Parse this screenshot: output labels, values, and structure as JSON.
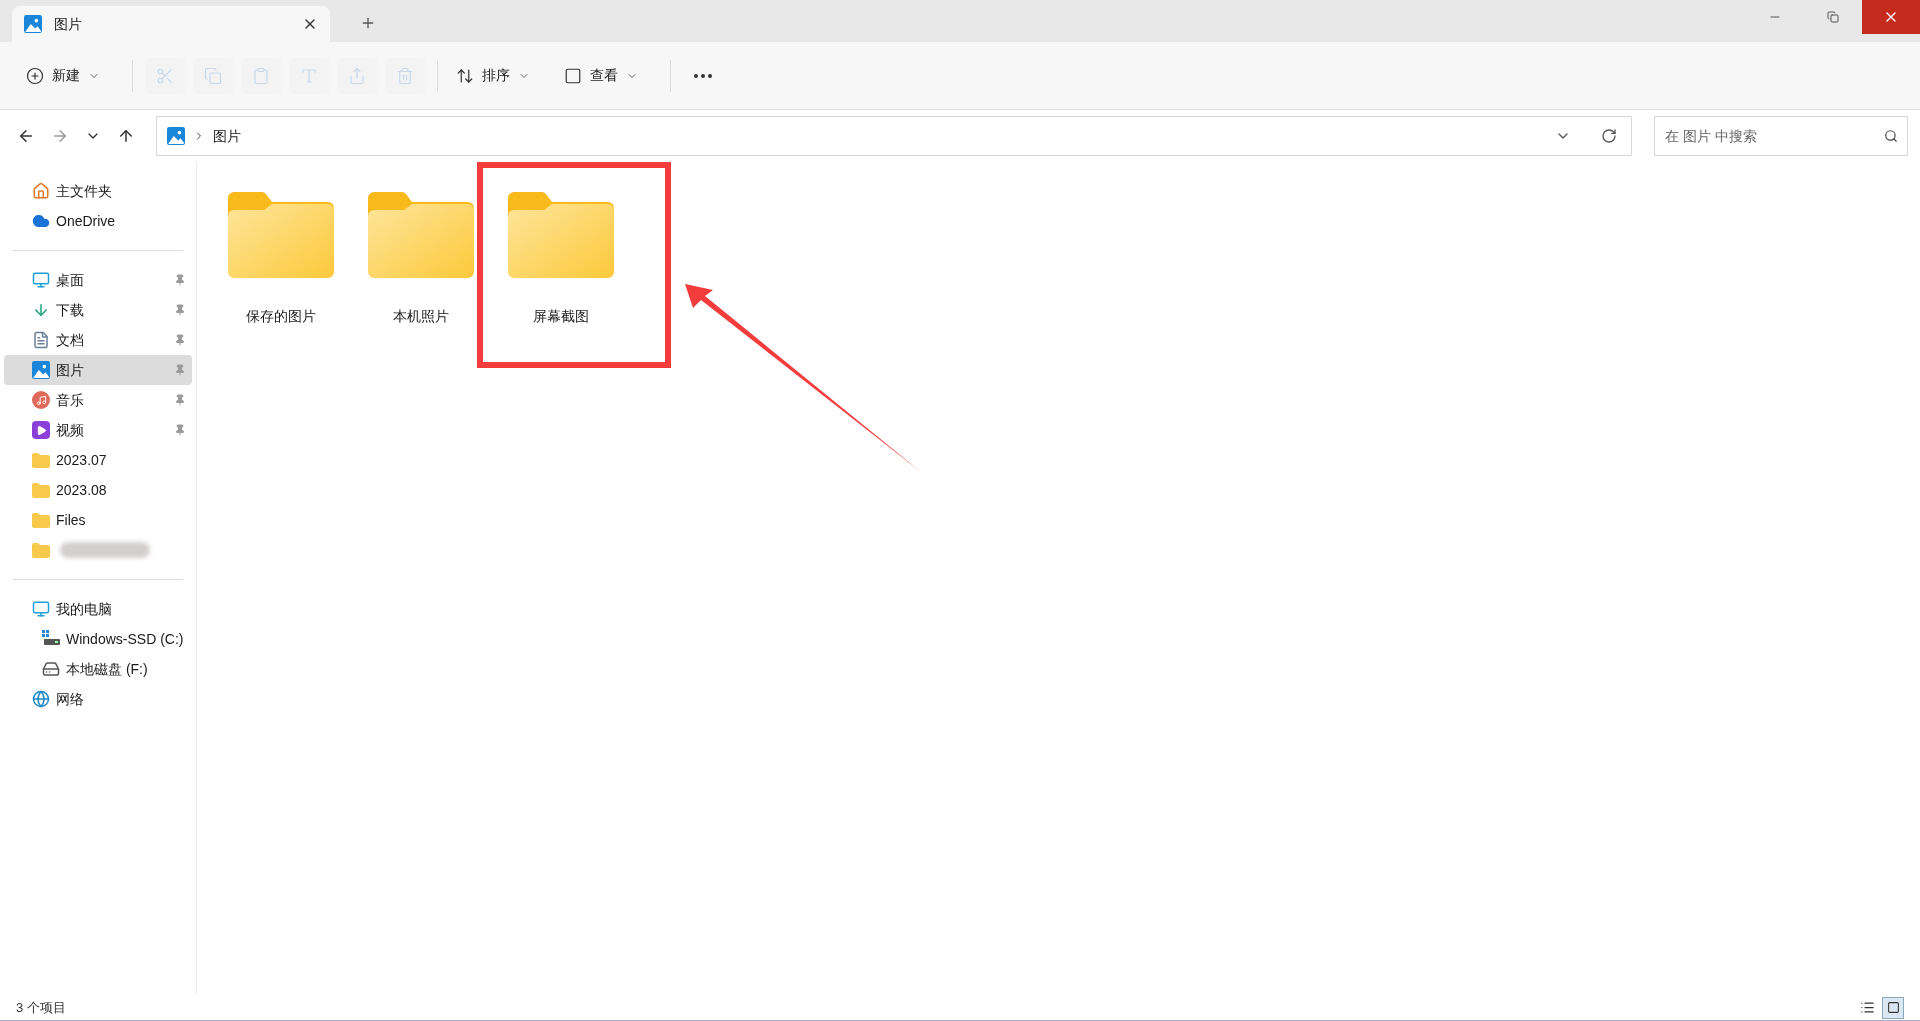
{
  "tab": {
    "title": "图片",
    "selected": true
  },
  "toolbar": [
    {
      "kind": "new",
      "label": "新建",
      "disabled": false
    },
    {
      "kind": "cut",
      "disabled": true
    },
    {
      "kind": "copy",
      "disabled": true
    },
    {
      "kind": "paste",
      "disabled": true
    },
    {
      "kind": "rename",
      "disabled": true
    },
    {
      "kind": "share",
      "disabled": true
    },
    {
      "kind": "delete",
      "disabled": true
    },
    {
      "kind": "sort",
      "label": "排序",
      "disabled": false
    },
    {
      "kind": "view",
      "label": "查看",
      "disabled": false
    },
    {
      "kind": "more",
      "disabled": false
    }
  ],
  "address": {
    "crumbs": [
      "图片"
    ]
  },
  "search": {
    "placeholder": "在 图片 中搜索"
  },
  "sidebar": {
    "groups": [
      [
        {
          "kind": "home",
          "label": "主文件夹",
          "pinned": false,
          "selected": false
        },
        {
          "kind": "cloud",
          "label": "OneDrive",
          "pinned": false,
          "selected": false
        }
      ],
      [
        {
          "kind": "desktop",
          "label": "桌面",
          "pinned": true,
          "selected": false
        },
        {
          "kind": "download",
          "label": "下载",
          "pinned": true,
          "selected": false
        },
        {
          "kind": "document",
          "label": "文档",
          "pinned": true,
          "selected": false
        },
        {
          "kind": "picture",
          "label": "图片",
          "pinned": true,
          "selected": true
        },
        {
          "kind": "music",
          "label": "音乐",
          "pinned": true,
          "selected": false
        },
        {
          "kind": "video",
          "label": "视频",
          "pinned": true,
          "selected": false
        },
        {
          "kind": "folder",
          "label": "2023.07",
          "pinned": false,
          "selected": false
        },
        {
          "kind": "folder",
          "label": "2023.08",
          "pinned": false,
          "selected": false
        },
        {
          "kind": "folder",
          "label": "Files",
          "pinned": false,
          "selected": false
        },
        {
          "kind": "redacted",
          "pinned": false,
          "selected": false
        }
      ],
      [
        {
          "kind": "pc",
          "label": "我的电脑",
          "pinned": false,
          "selected": false,
          "children": [
            {
              "kind": "system-drive",
              "label": "Windows-SSD (C:)",
              "pinned": false,
              "selected": false
            },
            {
              "kind": "drive",
              "label": "本地磁盘 (F:)",
              "pinned": false,
              "selected": false
            }
          ]
        },
        {
          "kind": "network",
          "label": "网络",
          "pinned": false,
          "selected": false
        }
      ]
    ]
  },
  "items": [
    {
      "label": "保存的图片",
      "highlighted": false
    },
    {
      "label": "本机照片",
      "highlighted": false
    },
    {
      "label": "屏幕截图",
      "highlighted": true
    }
  ],
  "status_bar": {
    "count": "3 个项目",
    "views": [
      {
        "kind": "details",
        "selected": false
      },
      {
        "kind": "tiles",
        "selected": true
      }
    ]
  }
}
